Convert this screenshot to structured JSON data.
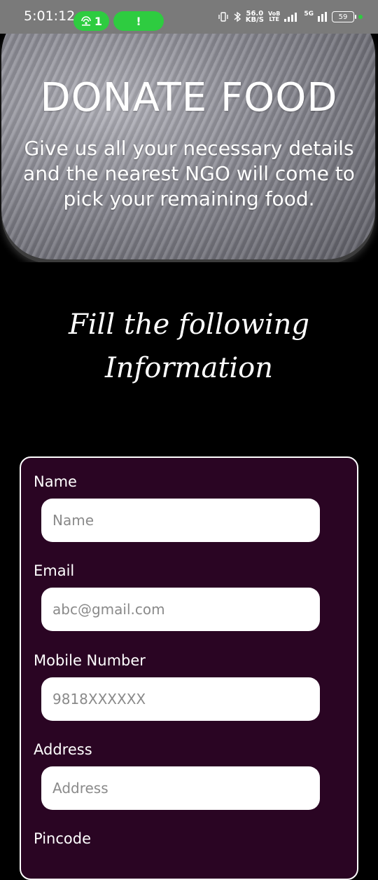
{
  "status_bar": {
    "time": "5:01:12",
    "hotspot_count": "1",
    "alert_symbol": "!",
    "network_speed_value": "56.0",
    "network_speed_unit": "KB/S",
    "volte_top": "VoB",
    "volte_bottom": "LTE",
    "network_5g": "5G",
    "battery": "59"
  },
  "hero": {
    "title": "DONATE FOOD",
    "subtitle": "Give us all your necessary details and the nearest NGO will come to pick your remaining food."
  },
  "heading": {
    "line1": "Fill the following",
    "line2": "Information"
  },
  "form": {
    "fields": [
      {
        "label": "Name",
        "placeholder": "Name"
      },
      {
        "label": "Email",
        "placeholder": "abc@gmail.com"
      },
      {
        "label": "Mobile Number",
        "placeholder": "9818XXXXXX"
      },
      {
        "label": "Address",
        "placeholder": "Address"
      },
      {
        "label": "Pincode"
      }
    ]
  },
  "colors": {
    "background": "#000000",
    "form_card": "#2a0523",
    "status_bar": "#7a7a7a",
    "pill_green": "#2ecc40"
  }
}
